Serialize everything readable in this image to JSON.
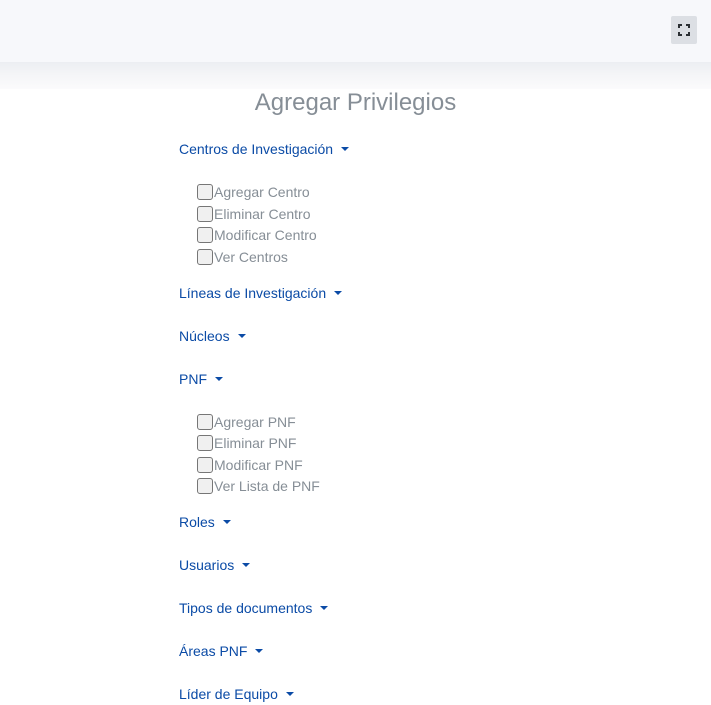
{
  "header": {
    "fullscreen_icon": "fullscreen-icon"
  },
  "title": "Agregar Privilegios",
  "sections": [
    {
      "label": "Centros de Investigación",
      "options": [
        "Agregar Centro",
        "Eliminar Centro",
        "Modificar Centro",
        "Ver Centros"
      ]
    },
    {
      "label": "Líneas de Investigación"
    },
    {
      "label": "Núcleos"
    },
    {
      "label": "PNF",
      "options": [
        "Agregar PNF",
        "Eliminar PNF",
        "Modificar PNF",
        "Ver Lista de PNF"
      ]
    },
    {
      "label": "Roles"
    },
    {
      "label": "Usuarios"
    },
    {
      "label": "Tipos de documentos"
    },
    {
      "label": "Áreas PNF"
    },
    {
      "label": "Líder de Equipo"
    }
  ]
}
